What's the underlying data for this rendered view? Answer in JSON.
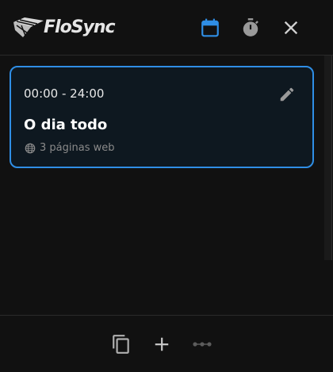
{
  "app": {
    "brand": "FloSync"
  },
  "header": {
    "icons": [
      "calendar-icon",
      "timer-icon",
      "close-icon"
    ],
    "accent_color": "#2f8ee5"
  },
  "schedule": {
    "items": [
      {
        "time_range": "00:00 - 24:00",
        "title": "O dia todo",
        "pages": "3 páginas web",
        "selected": true
      }
    ]
  },
  "footer": {
    "icons": [
      "copy-icon",
      "add-icon",
      "more-icon"
    ]
  },
  "colors": {
    "background": "#111111",
    "card_background": "#0e1820",
    "selected_border": "#2f8ee5",
    "muted_text": "#8a8a8a"
  }
}
